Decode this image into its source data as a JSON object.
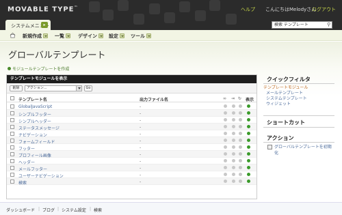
{
  "header": {
    "logo": "MOVABLE TYPE",
    "help": "ヘルプ",
    "user_text": "こんにちはMelodyさん",
    "logout": "ログアウト",
    "system_menu": "システムメニュー",
    "search_value": "検索 テンプレート"
  },
  "menu": {
    "items": [
      {
        "label": "新規作成"
      },
      {
        "label": "一覧"
      },
      {
        "label": "デザイン"
      },
      {
        "label": "設定"
      },
      {
        "label": "ツール"
      }
    ]
  },
  "page": {
    "title": "グローバルテンプレート",
    "create_link": "モジュールテンプレートを作成"
  },
  "panel": {
    "header": "テンプレートモジュールを表示",
    "delete_button": "削除",
    "action_select": "アクション...",
    "go_button": "Go",
    "columns": {
      "name": "テンプレート名",
      "output": "出力ファイル名",
      "show": "表示"
    },
    "rows": [
      {
        "name": "GlobalJavaScript",
        "file": "-"
      },
      {
        "name": "シンプルフッター",
        "file": "-"
      },
      {
        "name": "シンプルヘッダー",
        "file": "-"
      },
      {
        "name": "ステータスメッセージ",
        "file": "-"
      },
      {
        "name": "ナビゲーション",
        "file": "-"
      },
      {
        "name": "フォームフィールド",
        "file": "-"
      },
      {
        "name": "フッター",
        "file": "-"
      },
      {
        "name": "プロフィール画像",
        "file": "-"
      },
      {
        "name": "ヘッダー",
        "file": "-"
      },
      {
        "name": "メールフッター",
        "file": "-"
      },
      {
        "name": "ユーザーナビゲーション",
        "file": "-"
      },
      {
        "name": "検索",
        "file": "-"
      }
    ]
  },
  "sidebar": {
    "quick_filter_title": "クイックフィルタ",
    "quick_filters": [
      "テンプレートモジュール",
      "メールテンプレート",
      "システムテンプレート",
      "ウィジェット"
    ],
    "shortcut_title": "ショートカット",
    "action_title": "アクション",
    "action_link": "グローバルテンプレートを初期化"
  },
  "footer": {
    "links": [
      "ダッシュボード",
      "ブログ",
      "システム設定",
      "検索"
    ]
  },
  "colors": {
    "header_bg": "#2b2b2b",
    "accent_link": "#c8d84a",
    "status_on": "#3a9a2a",
    "status_off": "#c8c8c8"
  }
}
